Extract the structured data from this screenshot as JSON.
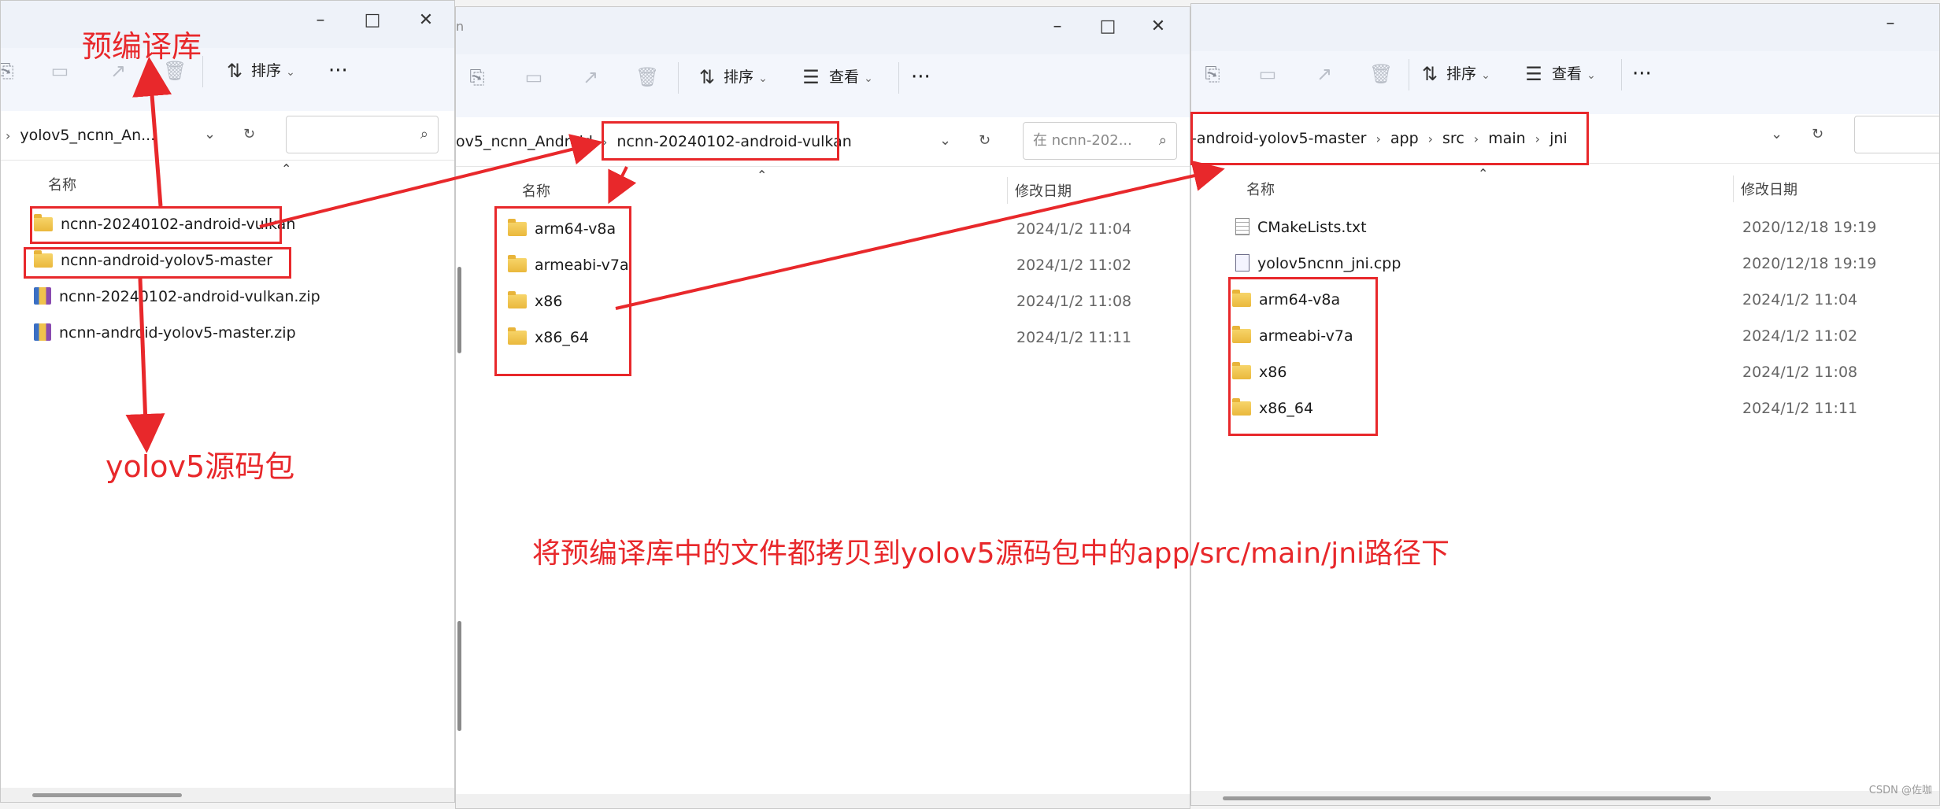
{
  "win1": {
    "window_controls": [
      "–",
      "□",
      "✕"
    ],
    "toolbar": {
      "sort_label": "排序"
    },
    "breadcrumb": [
      "yolov5_ncnn_An..."
    ],
    "search_placeholder": "",
    "column_name": "名称",
    "files": [
      {
        "name": "ncnn-20240102-android-vulkan",
        "type": "folder"
      },
      {
        "name": "ncnn-android-yolov5-master",
        "type": "folder"
      },
      {
        "name": "ncnn-20240102-android-vulkan.zip",
        "type": "zip"
      },
      {
        "name": "ncnn-android-yolov5-master.zip",
        "type": "zip"
      }
    ]
  },
  "win2": {
    "title_fragment": "n",
    "window_controls": [
      "–",
      "□",
      "✕"
    ],
    "toolbar": {
      "sort_label": "排序",
      "view_label": "查看"
    },
    "breadcrumb": [
      "ov5_ncnn_Android",
      "ncnn-20240102-android-vulkan"
    ],
    "search_placeholder": "在 ncnn-202...",
    "column_name": "名称",
    "column_date": "修改日期",
    "files": [
      {
        "name": "arm64-v8a",
        "date": "2024/1/2 11:04",
        "type": "folder"
      },
      {
        "name": "armeabi-v7a",
        "date": "2024/1/2 11:02",
        "type": "folder"
      },
      {
        "name": "x86",
        "date": "2024/1/2 11:08",
        "type": "folder"
      },
      {
        "name": "x86_64",
        "date": "2024/1/2 11:11",
        "type": "folder"
      }
    ]
  },
  "win3": {
    "window_controls": [
      "–"
    ],
    "toolbar": {
      "sort_label": "排序",
      "view_label": "查看"
    },
    "breadcrumb": [
      "-android-yolov5-master",
      "app",
      "src",
      "main",
      "jni"
    ],
    "column_name": "名称",
    "column_date": "修改日期",
    "files": [
      {
        "name": "CMakeLists.txt",
        "date": "2020/12/18 19:19",
        "type": "txt"
      },
      {
        "name": "yolov5ncnn_jni.cpp",
        "date": "2020/12/18 19:19",
        "type": "cpp"
      },
      {
        "name": "arm64-v8a",
        "date": "2024/1/2 11:04",
        "type": "folder"
      },
      {
        "name": "armeabi-v7a",
        "date": "2024/1/2 11:02",
        "type": "folder"
      },
      {
        "name": "x86",
        "date": "2024/1/2 11:08",
        "type": "folder"
      },
      {
        "name": "x86_64",
        "date": "2024/1/2 11:11",
        "type": "folder"
      }
    ]
  },
  "annotations": {
    "prebuilt_library": "预编译库",
    "source_package": "yolov5源码包",
    "instruction": "将预编译库中的文件都拷贝到yolov5源码包中的app/src/main/jni路径下",
    "accent_color": "#e8282b"
  },
  "watermark": "CSDN @佐咖"
}
